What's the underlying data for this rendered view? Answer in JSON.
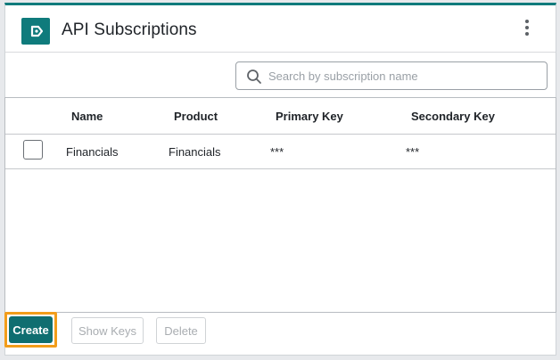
{
  "header": {
    "title": "API Subscriptions",
    "app_icon": "subscription-icon",
    "menu_icon": "kebab-menu-icon"
  },
  "search": {
    "placeholder": "Search by subscription name",
    "value": "",
    "icon": "search-icon"
  },
  "table": {
    "columns": [
      "Name",
      "Product",
      "Primary Key",
      "Secondary Key"
    ],
    "rows": [
      {
        "checked": false,
        "name": "Financials",
        "product": "Financials",
        "primary_key": "***",
        "secondary_key": "***"
      }
    ]
  },
  "footer": {
    "create_label": "Create",
    "show_keys_label": "Show Keys",
    "delete_label": "Delete"
  },
  "colors": {
    "accent": "#0f7b7c",
    "focus_ring": "#f29d1a"
  }
}
